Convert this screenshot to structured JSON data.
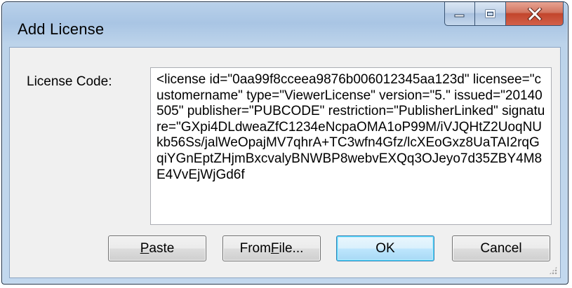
{
  "window": {
    "title": "Add License",
    "controls": {
      "minimize_icon": "minimize-icon",
      "maximize_icon": "maximize-icon",
      "close_icon": "close-icon"
    }
  },
  "form": {
    "license_label": "License Code:",
    "license_code": "<license id=\"0aa99f8cceea9876b006012345aa123d\" licensee=\"customername\" type=\"ViewerLicense\" version=\"5.\" issued=\"20140505\" publisher=\"PUBCODE\" restriction=\"PublisherLinked\" signature=\"GXpi4DLdweaZfC1234eNcpaOMA1oP99M/iVJQHtZ2UoqNUkb56Ss/jalWeOpajMV7qhrA+TC3wfn4Gfz/lcXEoGxz8UaTAI2rqGqiYGnEptZHjmBxcvalyBNWBP8webvEXQq3OJeyo7d35ZBY4M8E4VvEjWjGd6f"
  },
  "buttons": {
    "paste_accel": "P",
    "paste_rest": "aste",
    "from_file_pre": "From ",
    "from_file_accel": "F",
    "from_file_post": "ile...",
    "ok": "OK",
    "cancel": "Cancel"
  },
  "colors": {
    "close_button": "#c2452c",
    "default_button_border": "#3c7fb1"
  }
}
